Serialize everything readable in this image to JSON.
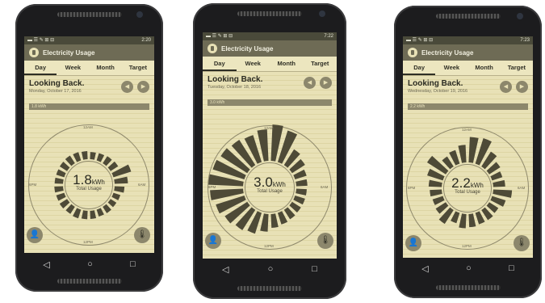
{
  "colors": {
    "bar": "#4e4a37",
    "ring": "#8f896c",
    "background": "#e8e1b6",
    "titlebar": "#6e6b55"
  },
  "phones": [
    {
      "status_time": "2:20",
      "app_title": "Electricity Usage",
      "tabs": [
        "Day",
        "Week",
        "Month",
        "Target"
      ],
      "heading": "Looking Back.",
      "date": "Monday, October 17, 2016",
      "bar_label": "1.8 kWh",
      "value": "1.8",
      "unit": "kWh",
      "center_label": "Total Usage",
      "hour_labels": {
        "top": "12AM",
        "right": "6AM",
        "bottom": "12PM",
        "left": "6PM"
      },
      "hourly_usage_relative": [
        0.22,
        0.25,
        0.3,
        0.34,
        1.0,
        0.64,
        0.4,
        0.22,
        0.2,
        0.24,
        0.22,
        0.28,
        0.3,
        0.35,
        0.3,
        0.33,
        0.3,
        0.32,
        0.3,
        0.3,
        0.32,
        0.35,
        0.32,
        0.28
      ]
    },
    {
      "status_time": "7:22",
      "app_title": "Electricity Usage",
      "tabs": [
        "Day",
        "Week",
        "Month",
        "Target"
      ],
      "heading": "Looking Back.",
      "date": "Tuesday, October 18, 2016",
      "bar_label": "3.0 kWh",
      "value": "3.0",
      "unit": "kWh",
      "center_label": "Total Usage",
      "hour_labels": {
        "top": "12AM",
        "right": "6AM",
        "bottom": "12PM",
        "left": "6PM"
      },
      "hourly_usage_relative": [
        1.0,
        0.9,
        0.45,
        0.35,
        0.25,
        0.22,
        0.2,
        0.2,
        0.2,
        0.22,
        0.25,
        0.3,
        0.42,
        0.55,
        0.62,
        0.7,
        0.8,
        0.9,
        0.95,
        0.9,
        0.85,
        0.8,
        0.75,
        0.85
      ]
    },
    {
      "status_time": "7:23",
      "app_title": "Electricity Usage",
      "tabs": [
        "Day",
        "Week",
        "Month",
        "Target"
      ],
      "heading": "Looking Back.",
      "date": "Wednesday, October 19, 2016",
      "bar_label": "2.2 kWh",
      "value": "2.2",
      "unit": "kWh",
      "center_label": "Total Usage",
      "hour_labels": {
        "top": "12AM",
        "right": "6AM",
        "bottom": "12PM",
        "left": "6PM"
      },
      "hourly_usage_relative": [
        0.95,
        1.0,
        0.6,
        0.4,
        0.3,
        0.35,
        0.65,
        0.45,
        0.3,
        0.35,
        0.35,
        0.4,
        0.45,
        0.3,
        0.55,
        0.35,
        0.3,
        0.35,
        0.4,
        0.55,
        0.8,
        0.35,
        0.45,
        0.6
      ]
    }
  ]
}
